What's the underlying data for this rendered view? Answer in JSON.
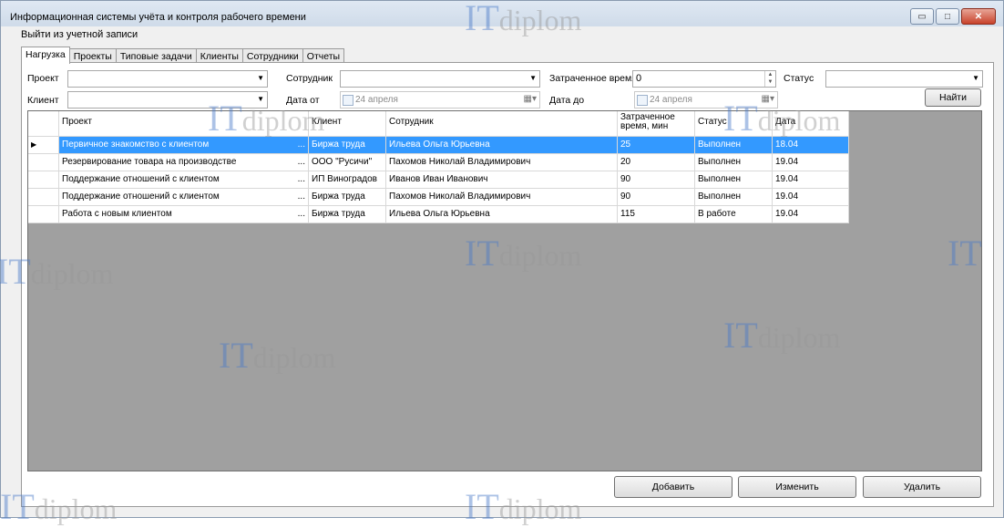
{
  "window": {
    "title": "Информационная системы учёта и контроля рабочего времени",
    "buttons": {
      "minimize": "▭",
      "maximize": "□",
      "close": "✕"
    }
  },
  "menu": {
    "logout": "Выйти из учетной записи"
  },
  "tabs": [
    "Нагрузка",
    "Проекты",
    "Типовые задачи",
    "Клиенты",
    "Сотрудники",
    "Отчеты"
  ],
  "filters": {
    "project_label": "Проект",
    "employee_label": "Сотрудник",
    "time_label": "Затраченное время",
    "status_label": "Статус",
    "client_label": "Клиент",
    "date_from_label": "Дата от",
    "date_to_label": "Дата до",
    "time_value": "0",
    "date_from_value": "24  апреля",
    "date_to_value": "24  апреля",
    "search_button": "Найти"
  },
  "grid": {
    "columns": [
      "Проект",
      "Клиент",
      "Сотрудник",
      "Затраченное время, мин",
      "Статус",
      "Дата"
    ],
    "rows": [
      [
        "Первичное знакомство с клиентом",
        "Биржа труда",
        "Ильева Ольга Юрьевна",
        "25",
        "Выполнен",
        "18.04"
      ],
      [
        "Резервирование товара на производстве",
        "ООО \"Русичи\"",
        "Пахомов Николай Владимирович",
        "20",
        "Выполнен",
        "19.04"
      ],
      [
        "Поддержание отношений с клиентом",
        "ИП Виноградов",
        "Иванов Иван Иванович",
        "90",
        "Выполнен",
        "19.04"
      ],
      [
        "Поддержание отношений с клиентом",
        "Биржа труда",
        "Пахомов Николай Владимирович",
        "90",
        "Выполнен",
        "19.04"
      ],
      [
        "Работа с новым клиентом",
        "Биржа труда",
        "Ильева Ольга Юрьевна",
        "115",
        "В работе",
        "19.04"
      ]
    ],
    "ellipsis": "..."
  },
  "actions": {
    "add": "Добавить",
    "edit": "Изменить",
    "delete": "Удалить"
  },
  "watermark": {
    "it": "IT",
    "diplom": "diplom"
  },
  "colors": {
    "selection": "#3399ff",
    "grid_background": "#a0a0a0",
    "close_button": "#c8422b"
  }
}
